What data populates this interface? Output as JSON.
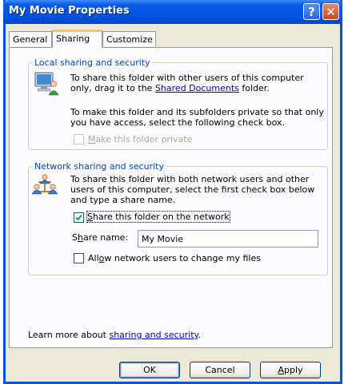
{
  "window": {
    "title": "My Movie Properties",
    "help_glyph": "?",
    "close_glyph": "✕"
  },
  "tabs": [
    {
      "label": "General",
      "active": false
    },
    {
      "label": "Sharing",
      "active": true
    },
    {
      "label": "Customize",
      "active": false
    }
  ],
  "local": {
    "legend": "Local sharing and security",
    "text1_prefix": "To share this folder with other users of this computer only, drag it to the ",
    "text1_link": "Shared Documents",
    "text1_suffix": " folder.",
    "text2": "To make this folder and its subfolders private so that only you have access, select the following check box.",
    "private_checkbox": {
      "label_pre": "",
      "label_ak": "M",
      "label_post": "ake this folder private",
      "checked": false,
      "enabled": false
    }
  },
  "network": {
    "legend": "Network sharing and security",
    "text": "To share this folder with both network users and other users of this computer, select the first check box below and type a share name.",
    "share_checkbox": {
      "label_pre": "",
      "label_ak": "S",
      "label_post": "hare this folder on the network",
      "checked": true
    },
    "share_name": {
      "label_pre": "S",
      "label_ak": "h",
      "label_post": "are name:",
      "value": "My Movie"
    },
    "allow_checkbox": {
      "label_pre": "All",
      "label_ak": "o",
      "label_post": "w network users to change my files",
      "checked": false
    }
  },
  "learn_more": {
    "prefix": "Learn more about ",
    "link": "sharing and security",
    "suffix": "."
  },
  "buttons": {
    "ok": "OK",
    "cancel": "Cancel",
    "apply_ak": "A",
    "apply_rest": "pply"
  },
  "colors": {
    "titlebar": "#0054e3",
    "group_legend": "#0046d5",
    "link": "#0000cc",
    "dialog_bg": "#ece9d8"
  },
  "icons": {
    "local": "computer-user-icon",
    "network": "network-users-icon",
    "check": "checkmark-icon"
  }
}
